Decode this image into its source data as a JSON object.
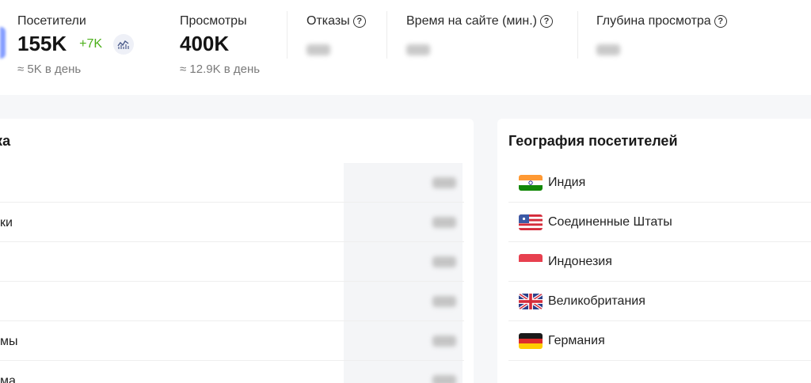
{
  "stats": {
    "visitors": {
      "label": "Посетители",
      "value": "155K",
      "delta": "+7K",
      "sub": "≈ 5K в день"
    },
    "pageviews": {
      "label": "Просмотры",
      "value": "400K",
      "sub": "≈ 12.9K в день"
    },
    "bounces": {
      "label": "Отказы",
      "help_icon": "?"
    },
    "time_on_site": {
      "label": "Время на сайте (мин.)",
      "help_icon": "?"
    },
    "depth": {
      "label": "Глубина просмотра",
      "help_icon": "?"
    }
  },
  "sources": {
    "title": "рика",
    "rows": [
      {
        "label": ""
      },
      {
        "label": "ки"
      },
      {
        "label": ""
      },
      {
        "label": ""
      },
      {
        "label": "мы"
      },
      {
        "label": "ма"
      }
    ]
  },
  "geography": {
    "title": "География посетителей",
    "rows": [
      {
        "country": "Индия",
        "flag": "india-flag"
      },
      {
        "country": "Соединенные Штаты",
        "flag": "usa-flag"
      },
      {
        "country": "Индонезия",
        "flag": "indonesia-flag"
      },
      {
        "country": "Великобритания",
        "flag": "uk-flag"
      },
      {
        "country": "Германия",
        "flag": "germany-flag"
      }
    ]
  },
  "colors": {
    "accent": "#5b7cff",
    "delta_positive": "#4caf1a",
    "muted_text": "#7a7a7a",
    "band_background": "#f6f7f9"
  },
  "icons": {
    "trend": "trend-chart-icon",
    "help": "question-circle-icon"
  }
}
